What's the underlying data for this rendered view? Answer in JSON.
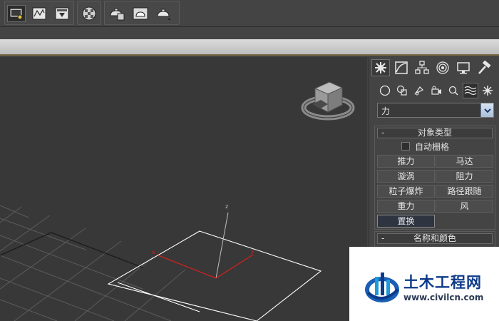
{
  "toolbar": {
    "buttons": [
      {
        "icon": "render-setup-icon",
        "active": true
      },
      {
        "icon": "render-frame-window-icon"
      },
      {
        "icon": "rendered-frame-icon"
      },
      {
        "icon": "material-editor-icon"
      },
      {
        "icon": "render-production-icon"
      },
      {
        "icon": "render-iterative-icon"
      },
      {
        "icon": "render-activeshade-icon"
      }
    ]
  },
  "command_panel": {
    "tabs": [
      "create-tab-icon",
      "modify-tab-icon",
      "hierarchy-tab-icon",
      "motion-tab-icon",
      "display-tab-icon",
      "utilities-tab-icon"
    ],
    "subtabs": [
      "geometry-icon",
      "shapes-icon",
      "lights-icon",
      "cameras-icon",
      "helpers-icon",
      "space-warps-icon",
      "systems-icon"
    ],
    "category_dropdown": {
      "value": "力"
    },
    "object_type": {
      "toggle": "-",
      "title": "对象类型",
      "autogrid_label": "自动栅格",
      "buttons": [
        "推力",
        "马达",
        "漩涡",
        "阻力",
        "粒子爆炸",
        "路径跟随",
        "重力",
        "风",
        "置换"
      ]
    },
    "name_color": {
      "toggle": "-",
      "title": "名称和颜色"
    }
  },
  "viewport": {
    "axis_labels": {
      "z": "z",
      "x": "x",
      "y": "y"
    }
  },
  "watermark": {
    "title": "土木工程网",
    "url": "www.civilcn.com"
  },
  "colors": {
    "viewport_bg": "#383838",
    "grid": "#5a5a5a",
    "selection": "#ffffff",
    "x_axis": "#d02020",
    "watermark_blue": "#0d3a8a"
  }
}
